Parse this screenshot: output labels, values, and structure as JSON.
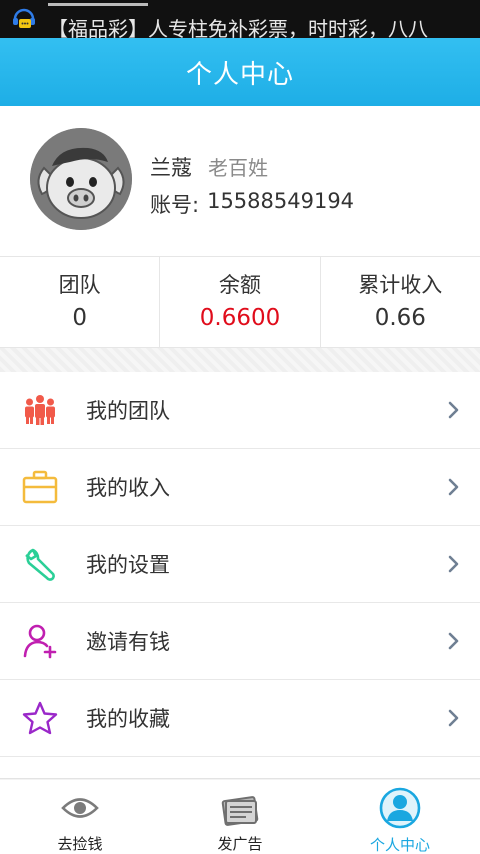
{
  "status_bar": {
    "ticker_text": "【福品彩】人专柱免补彩票，时时彩，八八"
  },
  "header": {
    "title": "个人中心"
  },
  "profile": {
    "name": "兰蔻",
    "role": "老百姓",
    "account_label": "账号:",
    "account_number": "15588549194"
  },
  "stats": [
    {
      "label": "团队",
      "value": "0"
    },
    {
      "label": "余额",
      "value": "0.6600",
      "color": "#e00c1b"
    },
    {
      "label": "累计收入",
      "value": "0.66"
    }
  ],
  "menu": [
    {
      "label": "我的团队",
      "icon": "team-icon",
      "color": "#f15a4a"
    },
    {
      "label": "我的收入",
      "icon": "briefcase-icon",
      "color": "#f4bb3c"
    },
    {
      "label": "我的设置",
      "icon": "wrench-icon",
      "color": "#2bcf97"
    },
    {
      "label": "邀请有钱",
      "icon": "add-user-icon",
      "color": "#c01fb0"
    },
    {
      "label": "我的收藏",
      "icon": "star-icon",
      "color": "#9a28c9"
    }
  ],
  "bottom_nav": [
    {
      "label": "去捡钱",
      "icon": "eye-icon"
    },
    {
      "label": "发广告",
      "icon": "ad-icon"
    },
    {
      "label": "个人中心",
      "icon": "person-icon",
      "active": true,
      "color": "#1aa7e0"
    }
  ],
  "colors": {
    "header_blue": "#22b4ea",
    "chevron": "#6f7f93"
  }
}
